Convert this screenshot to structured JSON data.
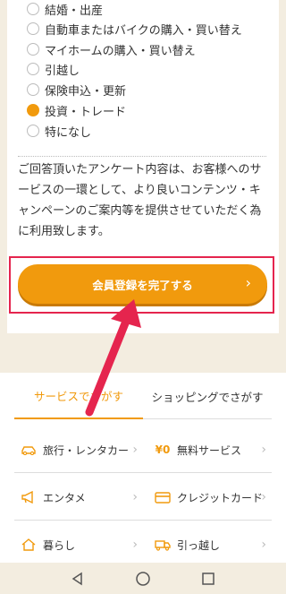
{
  "survey": {
    "options": [
      {
        "label": "結婚・出産",
        "checked": false
      },
      {
        "label": "自動車またはバイクの購入・買い替え",
        "checked": false
      },
      {
        "label": "マイホームの購入・買い替え",
        "checked": false
      },
      {
        "label": "引越し",
        "checked": false
      },
      {
        "label": "保険申込・更新",
        "checked": false
      },
      {
        "label": "投資・トレード",
        "checked": true
      },
      {
        "label": "特になし",
        "checked": false
      }
    ],
    "notice": "ご回答頂いたアンケート内容は、お客様へのサービスの一環として、より良いコンテンツ・キャンペーンのご案内等を提供させていただく為に利用致します。",
    "submit_label": "会員登録を完了する"
  },
  "tabs": [
    {
      "label": "サービスでさがす",
      "active": true
    },
    {
      "label": "ショッピングでさがす",
      "active": false
    }
  ],
  "categories": [
    {
      "label": "旅行・レンタカー",
      "icon": "car-icon"
    },
    {
      "label": "無料サービス",
      "icon": "yen-zero-icon",
      "icon_text": "¥0"
    },
    {
      "label": "エンタメ",
      "icon": "megaphone-icon"
    },
    {
      "label": "クレジットカード",
      "icon": "credit-card-icon"
    },
    {
      "label": "暮らし",
      "icon": "house-icon"
    },
    {
      "label": "引っ越し",
      "icon": "moving-truck-icon"
    }
  ],
  "colors": {
    "accent": "#f19a0d",
    "highlight_frame": "#e5254e",
    "background": "#f3ede0"
  }
}
